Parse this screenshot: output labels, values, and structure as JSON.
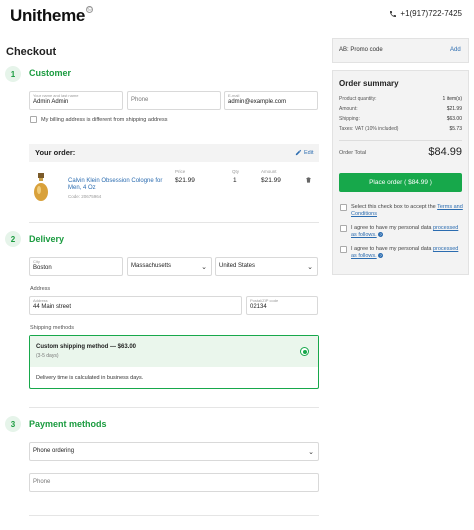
{
  "header": {
    "logo": "Unitheme",
    "logo_mark": "©",
    "phone": "+1(917)722-7425"
  },
  "page_title": "Checkout",
  "customer": {
    "step": "1",
    "title": "Customer",
    "name_label": "Your name and last name",
    "name_value": "Admin Admin",
    "phone_placeholder": "Phone",
    "email_label": "E-mail",
    "email_value": "admin@example.com",
    "billing_label": "My billing address is different from shipping address"
  },
  "order": {
    "title": "Your order:",
    "edit_label": "Edit",
    "col_price": "Price",
    "col_qty": "Qty",
    "col_amount": "Amount",
    "item_name": "Calvin Klein Obsession Cologne for Men, 4 Oz",
    "item_code": "Code: 20675964",
    "item_price": "$21.99",
    "item_qty": "1",
    "item_amount": "$21.99"
  },
  "delivery": {
    "step": "2",
    "title": "Delivery",
    "city_label": "City",
    "city_value": "Boston",
    "state_value": "Massachusetts",
    "country_value": "United States",
    "address_heading": "Address",
    "address_label": "Address",
    "address_value": "44 Main street",
    "postal_label": "Postal/ZIP code",
    "postal_value": "02134",
    "shipping_heading": "Shipping methods",
    "method_name": "Custom shipping method — $63.00",
    "method_days": "(3-5 days)",
    "method_note": "Delivery time is calculated in business days."
  },
  "payment": {
    "step": "3",
    "title": "Payment methods",
    "method_value": "Phone ordering",
    "phone_placeholder": "Phone"
  },
  "promo": {
    "label": "AB: Promo code",
    "add_label": "Add"
  },
  "summary": {
    "title": "Order summary",
    "rows": [
      {
        "label": "Product quantity:",
        "value": "1 item(s)"
      },
      {
        "label": "Amount:",
        "value": "$21.99"
      },
      {
        "label": "Shipping:",
        "value": "$63.00"
      },
      {
        "label": "Taxes: VAT (10% included)",
        "value": "$5.73"
      }
    ],
    "total_label": "Order Total",
    "total_value": "$84.99",
    "place_order": "Place order ( $84.99 )",
    "terms_text": "Select this check box to accept the ",
    "terms_link": "Terms and Conditions",
    "consent1_text": "I agree to have my personal data ",
    "consent1_link": "processed as follows.",
    "consent2_text": "I agree to have my personal data ",
    "consent2_link": "processed as follows."
  },
  "colors": {
    "accent": "#1a9b3f",
    "button": "#17a84b",
    "link": "#2b6cb0"
  }
}
